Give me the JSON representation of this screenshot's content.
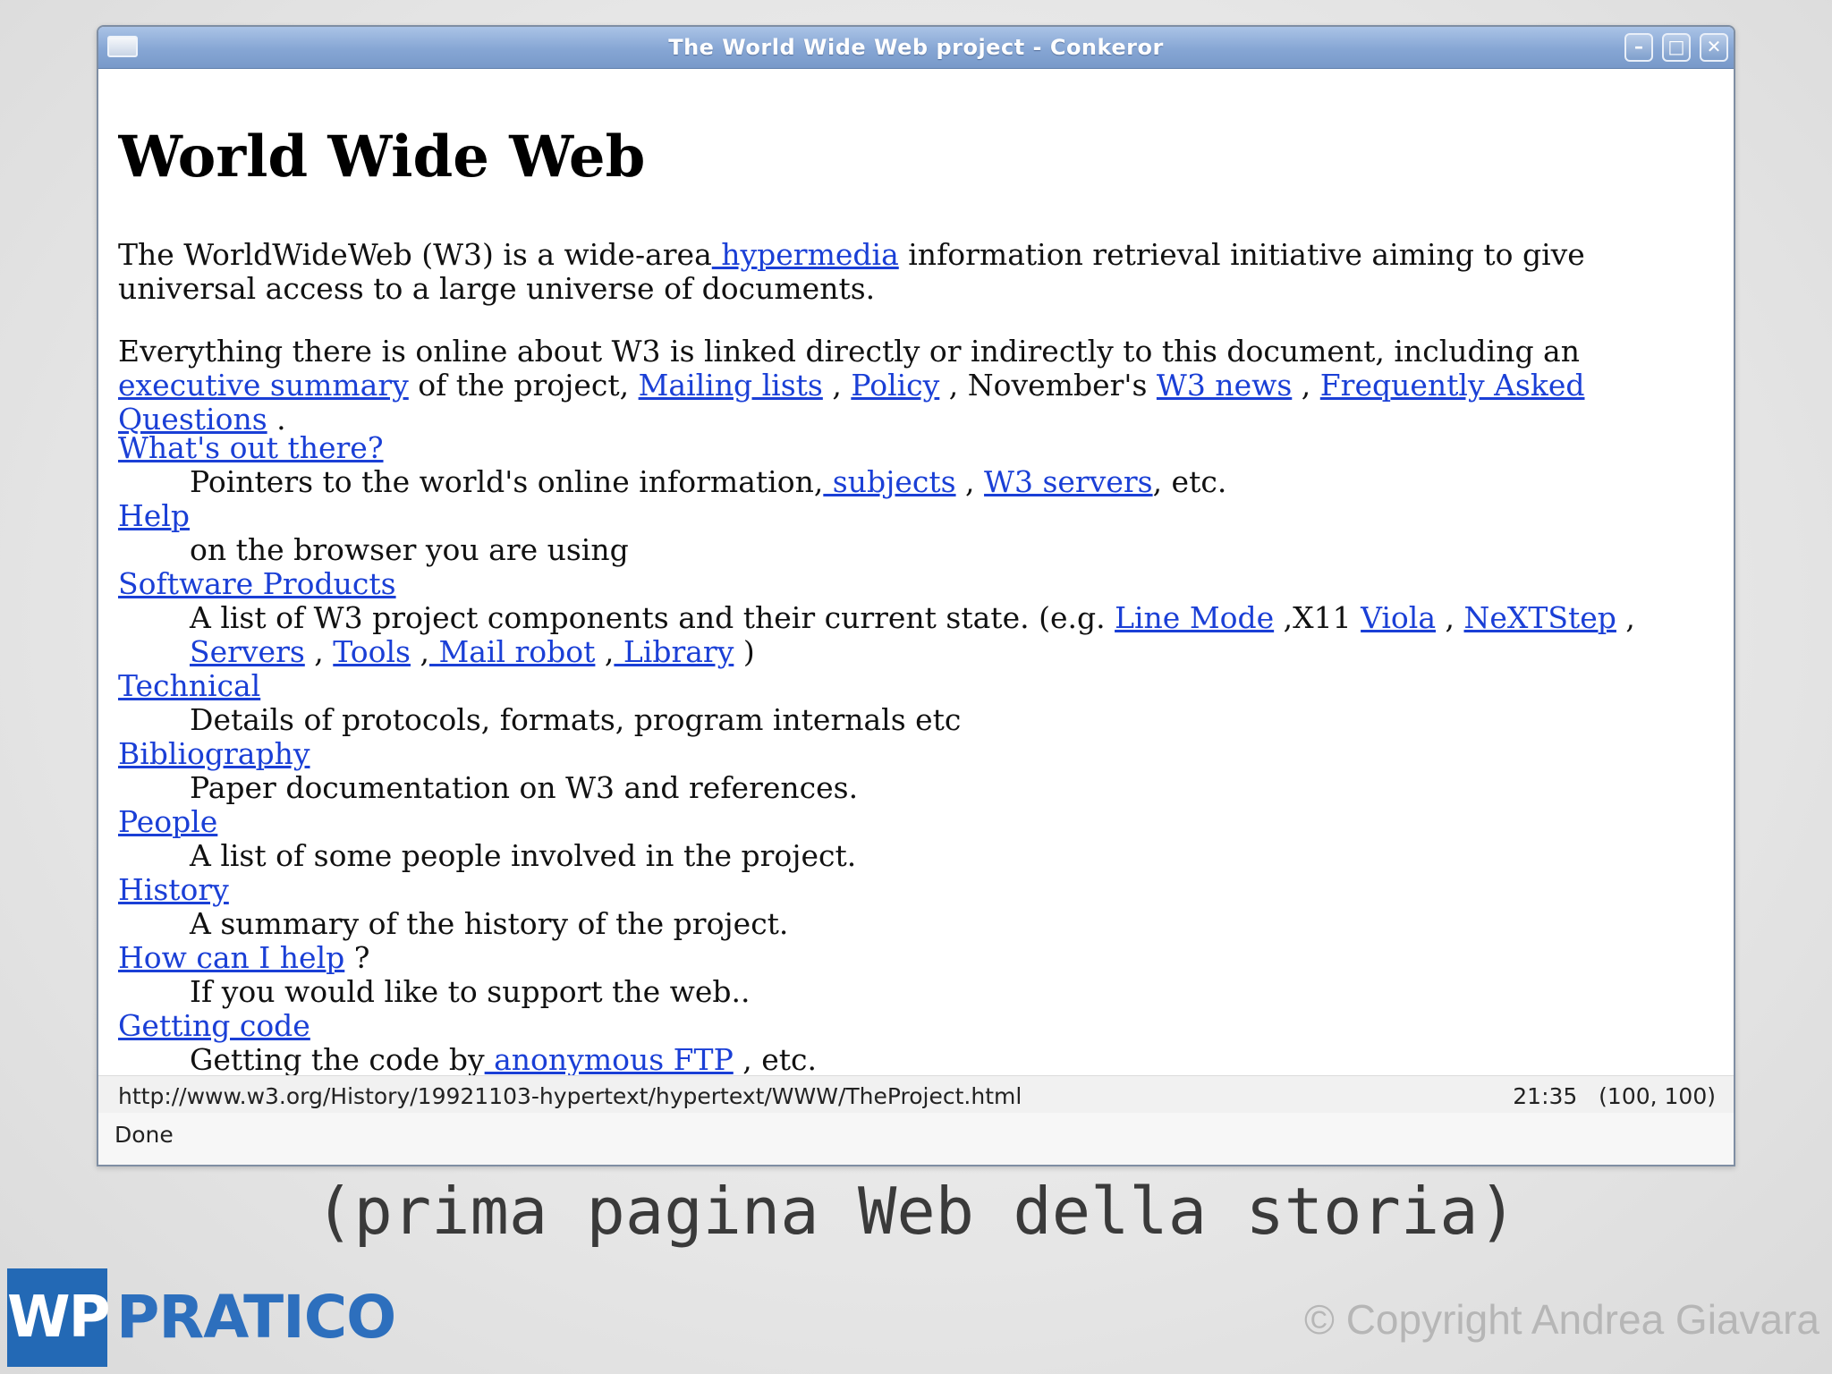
{
  "window": {
    "title": "The World Wide Web project - Conkeror",
    "minimize_glyph": "–",
    "maximize_glyph": "□",
    "close_glyph": "✕"
  },
  "page": {
    "heading": "World Wide Web",
    "para1": {
      "before": "The WorldWideWeb (W3) is a wide-area",
      "link": " hypermedia",
      "after": " information retrieval initiative aiming to give universal access to a large universe of documents."
    },
    "para2": {
      "t1": "Everything there is online about W3 is linked directly or indirectly to this document, including an ",
      "link_exec": "executive summary",
      "t2": " of the project, ",
      "link_mailing": "Mailing lists",
      "t3": " , ",
      "link_policy": "Policy",
      "t4": " , November's ",
      "link_news": "W3 news",
      "t5": " , ",
      "link_faq": "Frequently Asked Questions",
      "t6": " ."
    },
    "items": {
      "whats_out": {
        "term": "What's out there?",
        "d1": "Pointers to the world's online information,",
        "l1": " subjects",
        "d2": " , ",
        "l2": "W3 servers",
        "d3": ", etc."
      },
      "help": {
        "term": "Help",
        "desc": "on the browser you are using"
      },
      "software": {
        "term": "Software Products",
        "d1": "A list of W3 project components and their current state. (e.g. ",
        "l_linemode": "Line Mode",
        "d2": " ,X11 ",
        "l_viola": "Viola",
        "d3": " , ",
        "l_next": "NeXTStep",
        "d4": " , ",
        "l_servers": "Servers",
        "d5": " , ",
        "l_tools": "Tools",
        "d6": " ,",
        "l_mail": " Mail robot",
        "d7": " ,",
        "l_library": " Library",
        "d8": " )"
      },
      "technical": {
        "term": "Technical",
        "desc": "Details of protocols, formats, program internals etc"
      },
      "bibliography": {
        "term": "Bibliography",
        "desc": "Paper documentation on W3 and references."
      },
      "people": {
        "term": "People",
        "desc": "A list of some people involved in the project."
      },
      "history": {
        "term": "History",
        "desc": "A summary of the history of the project."
      },
      "howhelp": {
        "term": "How can I help",
        "suffix": " ?",
        "desc": "If you would like to support the web.."
      },
      "code": {
        "term": "Getting code",
        "d1": "Getting the code by",
        "l1": " anonymous FTP",
        "d2": " , etc."
      }
    }
  },
  "status": {
    "url": "http://www.w3.org/History/19921103-hypertext/hypertext/WWW/TheProject.html",
    "time": "21:35",
    "position": "(100, 100)",
    "message": "Done"
  },
  "caption": "(prima pagina Web della storia)",
  "logo": {
    "wp": "WP",
    "pratico": "PRATICO"
  },
  "copyright": "© Copyright Andrea Giavara",
  "colors": {
    "link": "#1a3fd6",
    "titlebar": "#86a6d4",
    "logo": "#2369b5"
  }
}
